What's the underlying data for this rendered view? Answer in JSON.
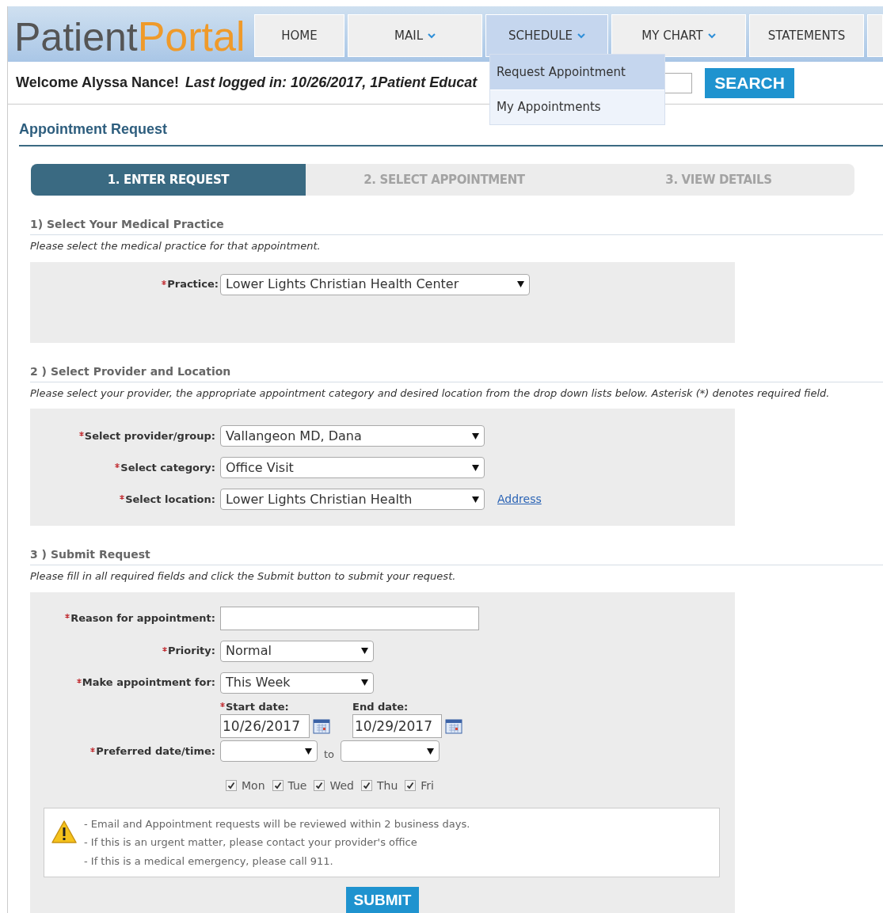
{
  "logo": {
    "first": "Patient",
    "second": "Portal"
  },
  "nav": [
    {
      "label": "HOME",
      "has_menu": false,
      "selected": false
    },
    {
      "label": "MAIL",
      "has_menu": true,
      "selected": false
    },
    {
      "label": "SCHEDULE",
      "has_menu": true,
      "selected": true
    },
    {
      "label": "MY CHART",
      "has_menu": true,
      "selected": false
    },
    {
      "label": "STATEMENTS",
      "has_menu": false,
      "selected": false
    }
  ],
  "schedule_menu": [
    {
      "label": "Request Appointment",
      "selected": true
    },
    {
      "label": "My Appointments",
      "selected": false
    }
  ],
  "welcome": {
    "greeting": "Welcome Alyssa Nance!",
    "last_login": "Last logged in: 10/26/2017, 1",
    "overlap": "Patient Educat"
  },
  "search": {
    "button": "SEARCH"
  },
  "page_title": "Appointment Request",
  "steps": [
    {
      "label": "1. ENTER REQUEST",
      "selected": true
    },
    {
      "label": "2. SELECT APPOINTMENT",
      "selected": false
    },
    {
      "label": "3. VIEW DETAILS",
      "selected": false
    }
  ],
  "sections": [
    {
      "title": "1) Select Your Medical Practice",
      "hint": "Please select the medical practice for that appointment.",
      "fields": [
        {
          "kind": "select",
          "label": "Practice:",
          "required": true,
          "value": "Lower Lights Christian Health Center"
        }
      ]
    },
    {
      "title": "2 ) Select Provider and Location",
      "hint": "Please select your provider, the appropriate appointment category and desired location from the drop down lists below. Asterisk (*) denotes required field.",
      "fields": [
        {
          "kind": "select",
          "label": "Select provider/group:",
          "required": true,
          "value": "Vallangeon MD, Dana"
        },
        {
          "kind": "select",
          "label": "Select category:",
          "required": true,
          "value": "Office Visit"
        },
        {
          "kind": "select",
          "label": "Select location:",
          "required": true,
          "value": "Lower Lights Christian Health",
          "link": "Address"
        }
      ]
    },
    {
      "title": "3 ) Submit Request",
      "hint": "Please fill in all required fields and click the Submit button to submit your request.",
      "fields": [
        {
          "kind": "text",
          "label": "Reason for appointment:",
          "required": true
        },
        {
          "kind": "select",
          "label": "Priority:",
          "required": true,
          "value": "Normal"
        },
        {
          "kind": "select",
          "label": "Make appointment for:",
          "required": true,
          "value": "This Week"
        },
        {
          "kind": "dates",
          "start_label": "Start date:",
          "start_required": true,
          "start_value": "10/26/2017",
          "end_label": "End date:",
          "end_required": false,
          "end_value": "10/29/2017"
        },
        {
          "kind": "range",
          "label": "Preferred date/time:",
          "required": true,
          "joiner": "to"
        },
        {
          "kind": "days",
          "days": [
            {
              "label": "Mon",
              "checked": true
            },
            {
              "label": "Tue",
              "checked": true
            },
            {
              "label": "Wed",
              "checked": true
            },
            {
              "label": "Thu",
              "checked": true
            },
            {
              "label": "Fri",
              "checked": true
            }
          ]
        }
      ]
    }
  ],
  "notice": [
    "- Email and Appointment requests will be reviewed within 2 business days.",
    "- If this is an urgent matter, please contact your provider's office",
    "- If this is a medical emergency, please call 911."
  ],
  "submit": "SUBMIT"
}
